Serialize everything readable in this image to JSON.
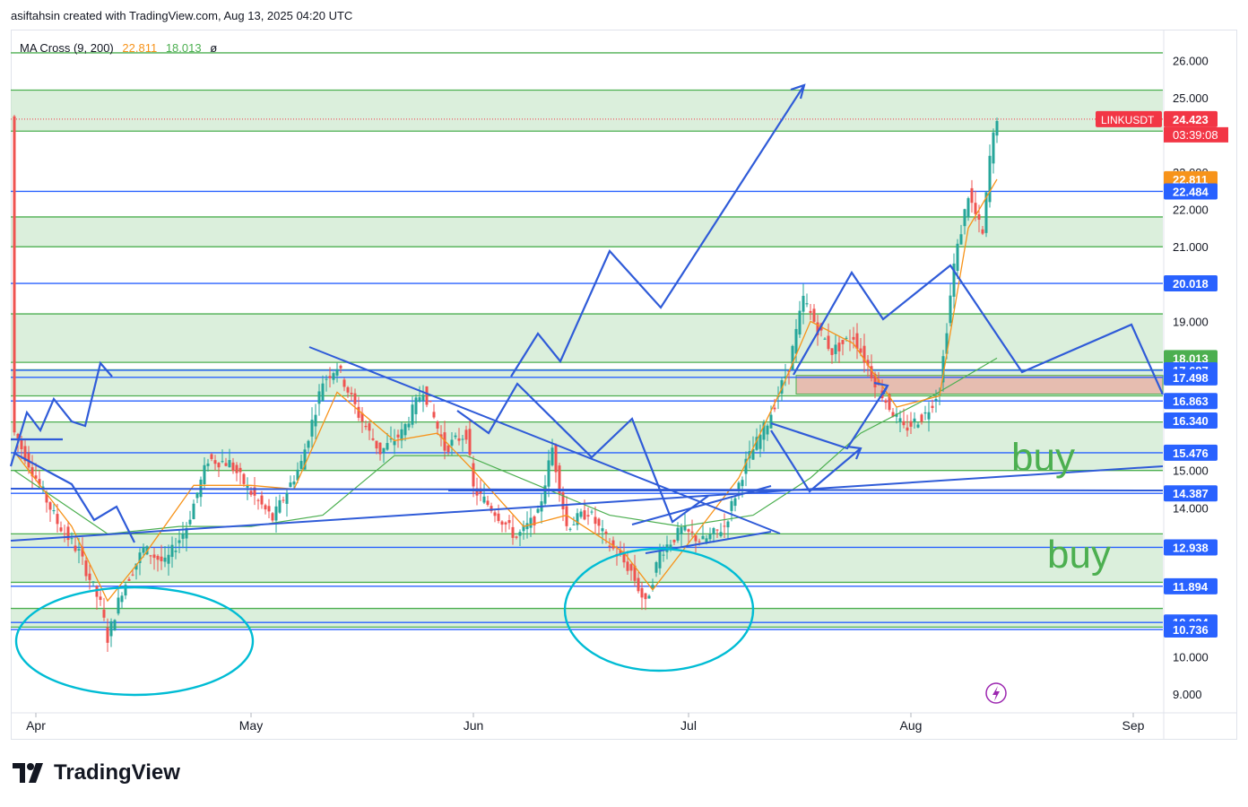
{
  "header": {
    "attribution": "asiftahsin created with TradingView.com, Aug 13, 2025 04:20 UTC"
  },
  "legend": {
    "indicator": "MA Cross (9, 200)",
    "ma_fast": "22.811",
    "ma_slow": "18.013",
    "extra": "ø"
  },
  "brand": {
    "name": "TradingView",
    "logo_icon": "tradingview-logo-icon"
  },
  "colors": {
    "zone_fill": "#c8e6c9",
    "zone_line": "#4caf50",
    "blue_line": "#2962ff",
    "drawing": "#2f5bd8",
    "cyan": "#00bcd4",
    "up": "#26a69a",
    "down": "#ef5350",
    "ma_fast": "#f7931a",
    "ma_slow": "#4caf50",
    "red_zone": "#e8b4a8",
    "buy_text": "#4caf50"
  },
  "chart_data": {
    "type": "line",
    "symbol": "LINKUSDT",
    "last_price": "24.423",
    "countdown": "03:39:08",
    "ylim": [
      8.5,
      26.8
    ],
    "y_ticks": [
      "26.000",
      "25.000",
      "23.000",
      "22.000",
      "21.000",
      "19.000",
      "15.000",
      "14.000",
      "10.000",
      "9.000"
    ],
    "x_ticks": [
      "Apr",
      "May",
      "Jun",
      "Jul",
      "Aug",
      "Sep"
    ],
    "x_tick_days": [
      0,
      30,
      61,
      91,
      122,
      153
    ],
    "price_labels": [
      {
        "text": "24.423",
        "value": 24.423,
        "color": "#f23645"
      },
      {
        "text": "22.811",
        "value": 22.811,
        "color": "#f7931a"
      },
      {
        "text": "22.484",
        "value": 22.484,
        "color": "#2962ff"
      },
      {
        "text": "20.018",
        "value": 20.018,
        "color": "#2962ff"
      },
      {
        "text": "18.013",
        "value": 18.013,
        "color": "#4caf50"
      },
      {
        "text": "17.687",
        "value": 17.687,
        "color": "#2962ff"
      },
      {
        "text": "17.498",
        "value": 17.498,
        "color": "#2962ff"
      },
      {
        "text": "16.863",
        "value": 16.863,
        "color": "#2962ff"
      },
      {
        "text": "16.340",
        "value": 16.34,
        "color": "#2962ff"
      },
      {
        "text": "15.476",
        "value": 15.476,
        "color": "#2962ff"
      },
      {
        "text": "14.387",
        "value": 14.387,
        "color": "#2962ff"
      },
      {
        "text": "12.938",
        "value": 12.938,
        "color": "#2962ff"
      },
      {
        "text": "11.894",
        "value": 11.894,
        "color": "#2962ff"
      },
      {
        "text": "10.924",
        "value": 10.924,
        "color": "#2962ff"
      },
      {
        "text": "10.736",
        "value": 10.736,
        "color": "#2962ff"
      }
    ],
    "zones": [
      [
        24.1,
        25.2
      ],
      [
        21.0,
        21.8
      ],
      [
        17.9,
        19.2
      ],
      [
        17.0,
        17.7
      ],
      [
        15.0,
        16.3
      ],
      [
        12.0,
        13.3
      ],
      [
        10.8,
        11.3
      ]
    ],
    "hlines": [
      26.2,
      22.484,
      20.018,
      17.687,
      17.498,
      16.863,
      15.476,
      14.387,
      12.938,
      11.894,
      10.924,
      10.736
    ],
    "price_path": [
      [
        -3,
        16.0
      ],
      [
        0,
        14.8
      ],
      [
        3,
        13.6
      ],
      [
        6,
        12.8
      ],
      [
        9,
        11.4
      ],
      [
        10,
        10.5
      ],
      [
        12,
        11.8
      ],
      [
        15,
        12.9
      ],
      [
        18,
        12.5
      ],
      [
        21,
        13.5
      ],
      [
        24,
        15.3
      ],
      [
        27,
        15.2
      ],
      [
        30,
        14.4
      ],
      [
        33,
        13.7
      ],
      [
        37,
        15.2
      ],
      [
        40,
        17.4
      ],
      [
        42,
        17.8
      ],
      [
        45,
        16.5
      ],
      [
        48,
        15.5
      ],
      [
        51,
        16.0
      ],
      [
        54,
        17.2
      ],
      [
        57,
        15.6
      ],
      [
        60,
        16.0
      ],
      [
        61,
        14.5
      ],
      [
        64,
        13.9
      ],
      [
        67,
        13.2
      ],
      [
        70,
        13.8
      ],
      [
        72,
        15.6
      ],
      [
        74,
        13.5
      ],
      [
        77,
        13.9
      ],
      [
        80,
        13.0
      ],
      [
        83,
        12.3
      ],
      [
        85,
        11.4
      ],
      [
        87,
        12.8
      ],
      [
        90,
        13.4
      ],
      [
        93,
        13.1
      ],
      [
        96,
        13.5
      ],
      [
        99,
        15.2
      ],
      [
        102,
        16.3
      ],
      [
        105,
        17.8
      ],
      [
        107,
        19.6
      ],
      [
        109,
        18.8
      ],
      [
        111,
        18.2
      ],
      [
        114,
        18.6
      ],
      [
        117,
        17.4
      ],
      [
        119,
        16.7
      ],
      [
        121,
        16.1
      ],
      [
        124,
        16.5
      ],
      [
        126,
        17.2
      ],
      [
        128,
        20.5
      ],
      [
        130,
        22.4
      ],
      [
        132,
        21.3
      ],
      [
        133,
        23.4
      ],
      [
        134,
        24.5
      ]
    ],
    "ma_fast": [
      [
        -3,
        15.5
      ],
      [
        5,
        13.5
      ],
      [
        10,
        11.5
      ],
      [
        15,
        12.7
      ],
      [
        22,
        14.6
      ],
      [
        30,
        14.6
      ],
      [
        36,
        14.5
      ],
      [
        42,
        17.1
      ],
      [
        50,
        15.8
      ],
      [
        56,
        16.0
      ],
      [
        61,
        15.0
      ],
      [
        68,
        13.5
      ],
      [
        74,
        13.8
      ],
      [
        82,
        12.8
      ],
      [
        86,
        11.8
      ],
      [
        92,
        13.3
      ],
      [
        98,
        14.8
      ],
      [
        104,
        17.2
      ],
      [
        108,
        19.0
      ],
      [
        114,
        18.4
      ],
      [
        120,
        16.7
      ],
      [
        126,
        17.0
      ],
      [
        130,
        21.5
      ],
      [
        134,
        22.811
      ]
    ],
    "ma_slow": [
      [
        -3,
        15.0
      ],
      [
        10,
        13.3
      ],
      [
        20,
        13.5
      ],
      [
        30,
        13.5
      ],
      [
        40,
        13.8
      ],
      [
        50,
        15.4
      ],
      [
        60,
        15.4
      ],
      [
        70,
        14.6
      ],
      [
        80,
        13.8
      ],
      [
        90,
        13.5
      ],
      [
        100,
        13.8
      ],
      [
        108,
        14.8
      ],
      [
        115,
        16.0
      ],
      [
        125,
        17.0
      ],
      [
        134,
        18.013
      ]
    ],
    "annotations": [
      {
        "text": "buy",
        "day": 136,
        "value": 15.0
      },
      {
        "text": "buy",
        "day": 141,
        "value": 12.4
      }
    ]
  }
}
